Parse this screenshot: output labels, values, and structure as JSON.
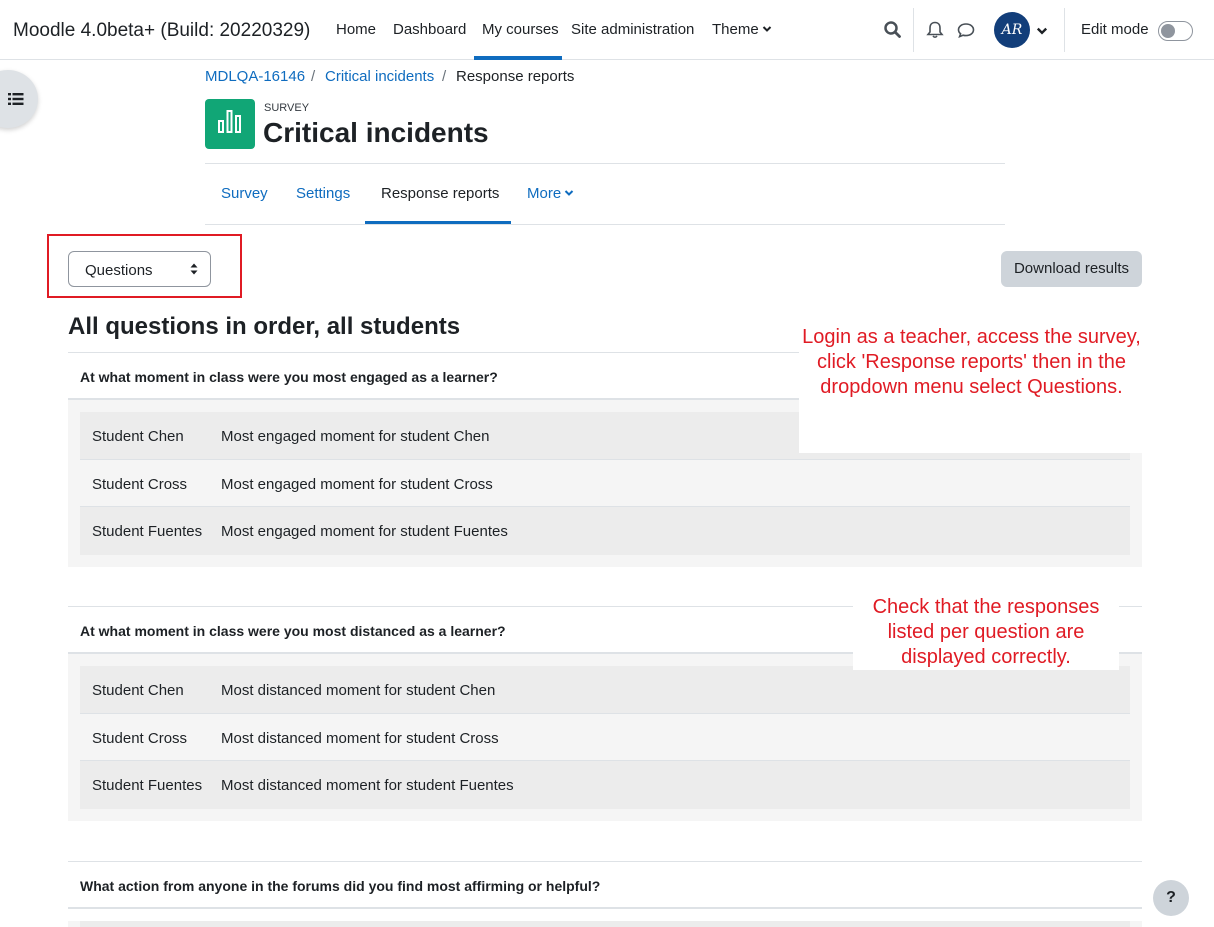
{
  "navbar": {
    "site_name": "Moodle 4.0beta+ (Build: 20220329)",
    "links": [
      "Home",
      "Dashboard",
      "My courses",
      "Site administration",
      "Theme"
    ],
    "user_initials": "AR",
    "edit_mode_label": "Edit mode"
  },
  "breadcrumb": {
    "course": "MDLQA-16146",
    "activity": "Critical incidents",
    "current": "Response reports"
  },
  "header": {
    "module_label": "SURVEY",
    "title": "Critical incidents"
  },
  "tabs": [
    "Survey",
    "Settings",
    "Response reports",
    "More"
  ],
  "report_select": {
    "value": "Questions"
  },
  "download_button": "Download results",
  "section_heading": "All questions in order, all students",
  "questions": [
    {
      "text": "At what moment in class were you most engaged as a learner?",
      "responses": [
        {
          "student": "Student Chen",
          "answer": "Most engaged moment for student Chen"
        },
        {
          "student": "Student Cross",
          "answer": "Most engaged moment for student Cross"
        },
        {
          "student": "Student Fuentes",
          "answer": "Most engaged moment for student Fuentes"
        }
      ]
    },
    {
      "text": "At what moment in class were you most distanced as a learner?",
      "responses": [
        {
          "student": "Student Chen",
          "answer": "Most distanced moment for student Chen"
        },
        {
          "student": "Student Cross",
          "answer": "Most distanced moment for student Cross"
        },
        {
          "student": "Student Fuentes",
          "answer": "Most distanced moment for student Fuentes"
        }
      ]
    },
    {
      "text": "What action from anyone in the forums did you find most affirming or helpful?",
      "responses": []
    }
  ],
  "annotations": [
    "Login as a teacher, access the survey, click 'Response reports' then in the dropdown menu select Questions.",
    "Check that the responses listed per question are displayed correctly."
  ],
  "help_button": "?",
  "colors": {
    "primary": "#0f6cbf",
    "survey_icon": "#11a676",
    "annotation": "#e01b24"
  }
}
